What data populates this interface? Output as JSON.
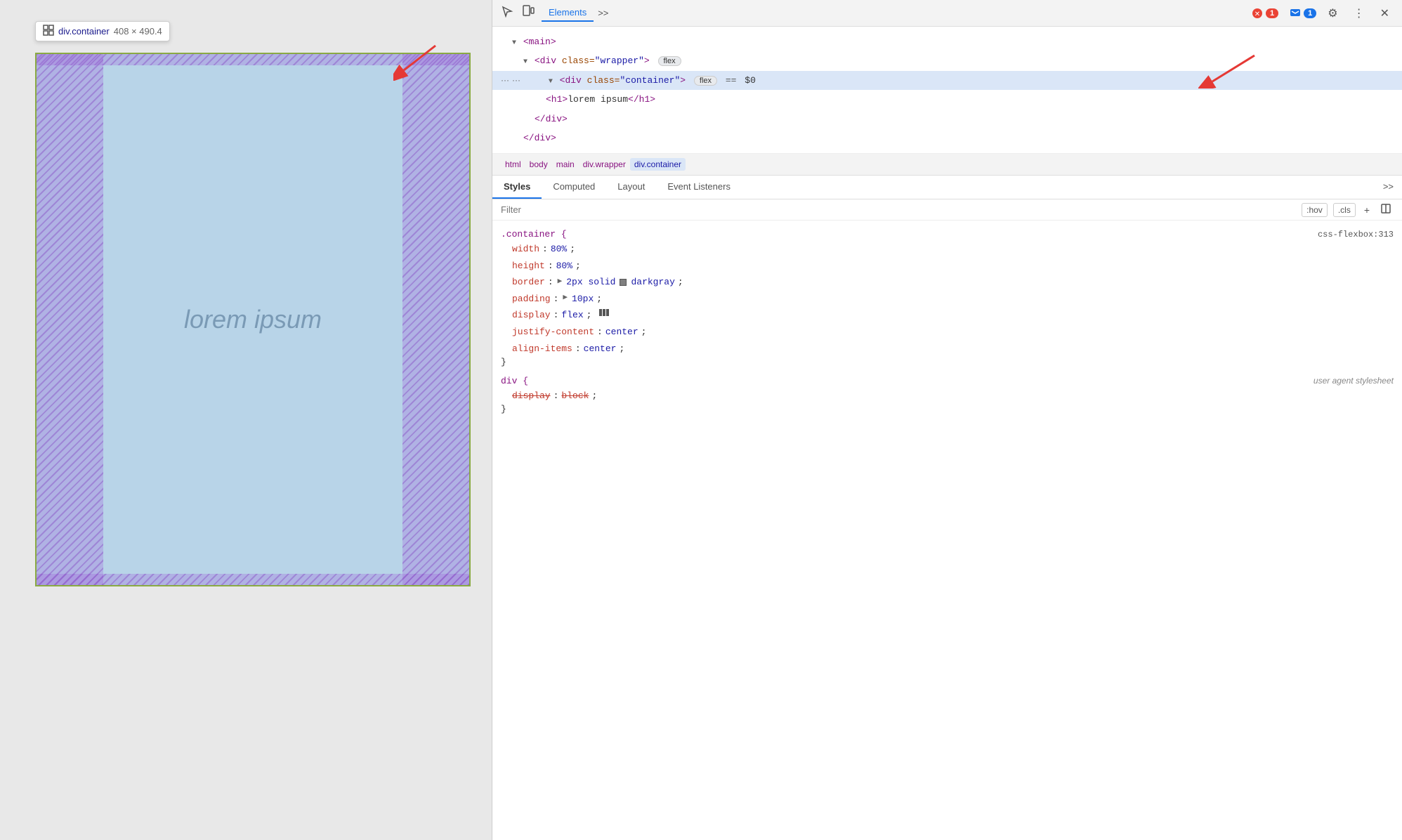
{
  "viewport": {
    "tooltip": {
      "selector": "div.container",
      "dimensions": "408 × 490.4"
    },
    "lorem_text": "lorem ipsum"
  },
  "devtools": {
    "tabs": [
      "Elements",
      ">>"
    ],
    "active_tab": "Elements",
    "badge_red": "1",
    "badge_blue": "1",
    "elements": {
      "lines": [
        {
          "indent": 1,
          "content": "<main>"
        },
        {
          "indent": 2,
          "content": "<div class=\"wrapper\">",
          "badge": "flex"
        },
        {
          "indent": 3,
          "content": "<div class=\"container\">",
          "badge": "flex",
          "selected": true,
          "eq": "== $0"
        },
        {
          "indent": 4,
          "content": "<h1>lorem ipsum</h1>"
        },
        {
          "indent": 3,
          "content": "</div>"
        },
        {
          "indent": 2,
          "content": "</div>"
        }
      ]
    },
    "breadcrumb": [
      {
        "label": "html",
        "active": false
      },
      {
        "label": "body",
        "active": false
      },
      {
        "label": "main",
        "active": false
      },
      {
        "label": "div.wrapper",
        "active": false
      },
      {
        "label": "div.container",
        "active": true
      }
    ],
    "styles_tabs": [
      {
        "label": "Styles",
        "active": true
      },
      {
        "label": "Computed",
        "active": false
      },
      {
        "label": "Layout",
        "active": false
      },
      {
        "label": "Event Listeners",
        "active": false
      },
      {
        "label": ">>",
        "active": false
      }
    ],
    "filter": {
      "placeholder": "Filter",
      "hov": ":hov",
      "cls": ".cls"
    },
    "css_rules": [
      {
        "selector": ".container {",
        "source": "css-flexbox:313",
        "source_link": true,
        "props": [
          {
            "name": "width",
            "value": "80%",
            "strikethrough": false
          },
          {
            "name": "height",
            "value": "80%",
            "strikethrough": false
          },
          {
            "name": "border",
            "value": "2px solid",
            "color": "darkgray",
            "has_color": true,
            "strikethrough": false
          },
          {
            "name": "padding",
            "value": "10px",
            "has_triangle": true,
            "strikethrough": false
          },
          {
            "name": "display",
            "value": "flex",
            "has_flex_icon": true,
            "strikethrough": false
          },
          {
            "name": "justify-content",
            "value": "center",
            "strikethrough": false
          },
          {
            "name": "align-items",
            "value": "center",
            "strikethrough": false
          }
        ]
      },
      {
        "selector": "div {",
        "source": "user agent stylesheet",
        "source_italic": true,
        "props": [
          {
            "name": "display",
            "value": "block",
            "strikethrough": true
          }
        ]
      }
    ]
  }
}
